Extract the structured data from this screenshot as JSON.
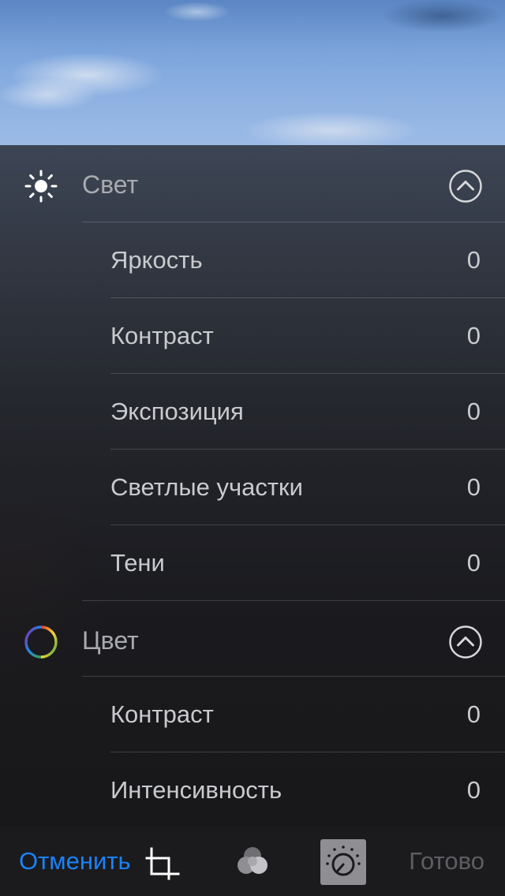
{
  "light_section": {
    "title": "Свет",
    "icon": "sun-icon",
    "items": [
      {
        "label": "Яркость",
        "value": "0"
      },
      {
        "label": "Контраст",
        "value": "0"
      },
      {
        "label": "Экспозиция",
        "value": "0"
      },
      {
        "label": "Светлые участки",
        "value": "0"
      },
      {
        "label": "Тени",
        "value": "0"
      }
    ]
  },
  "color_section": {
    "title": "Цвет",
    "icon": "color-wheel-icon",
    "items": [
      {
        "label": "Контраст",
        "value": "0"
      },
      {
        "label": "Интенсивность",
        "value": "0"
      }
    ]
  },
  "toolbar": {
    "cancel_label": "Отменить",
    "done_label": "Готово",
    "tools": [
      "crop-icon",
      "filters-icon",
      "adjust-dial-icon"
    ],
    "active_tool": "adjust-dial-icon"
  },
  "colors": {
    "accent": "#1a82fb",
    "text": "#c9cacd",
    "muted": "#a9aaaf",
    "disabled": "#5e5e62"
  }
}
